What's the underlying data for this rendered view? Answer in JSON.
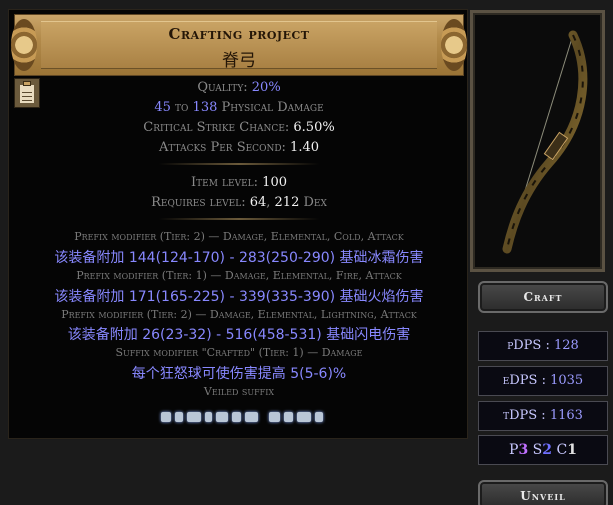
{
  "item": {
    "header_title": "Crafting project",
    "base_name": "脊弓",
    "properties": {
      "quality_label": "Quality: ",
      "quality_value": "20%",
      "phys_min": "45",
      "phys_to": " to ",
      "phys_max": "138",
      "phys_label": " Physical Damage",
      "crit_label": "Critical Strike Chance: ",
      "crit_value": "6.50%",
      "aps_label": "Attacks Per Second: ",
      "aps_value": "1.40"
    },
    "requirements": {
      "item_level_label": "Item level: ",
      "item_level_value": "100",
      "requires_label": "Requires level: ",
      "requires_level": "64",
      "requires_sep": ", ",
      "requires_dex": "212",
      "requires_dex_label": " Dex"
    },
    "modifiers": [
      {
        "header": "Prefix modifier (Tier: 2) — Damage, Elemental, Cold, Attack",
        "value": "该装备附加 144(124-170) - 283(250-290) 基础冰霜伤害"
      },
      {
        "header": "Prefix modifier (Tier: 1) — Damage, Elemental, Fire, Attack",
        "value": "该装备附加 171(165-225) - 339(335-390) 基础火焰伤害"
      },
      {
        "header": "Prefix modifier (Tier: 2) — Damage, Elemental, Lightning, Attack",
        "value": "该装备附加 26(23-32) - 516(458-531) 基础闪电伤害"
      },
      {
        "header": "Suffix modifier \"Crafted\" (Tier: 1) — Damage",
        "value": "每个狂怒球可使伤害提高 5(5-6)%"
      }
    ],
    "veiled_label": "Veiled suffix"
  },
  "panel": {
    "craft_label": "Craft",
    "unveil_label": "Unveil",
    "pdps_label": "pDPS : ",
    "pdps_value": "128",
    "edps_label": "eDPS : ",
    "edps_value": "1035",
    "tdps_label": "tDPS : ",
    "tdps_value": "1163",
    "sockets": {
      "p_label": "P",
      "p_value": "3",
      "s_label": "S",
      "s_value": "2",
      "c_label": "C",
      "c_value": "1"
    }
  },
  "icons": {
    "clipboard": "clipboard-icon",
    "item_art": "bow-icon"
  },
  "colors": {
    "header_gold": "#b28a4a",
    "magic_blue": "#8888ff",
    "socket_purple": "#c070ff"
  }
}
